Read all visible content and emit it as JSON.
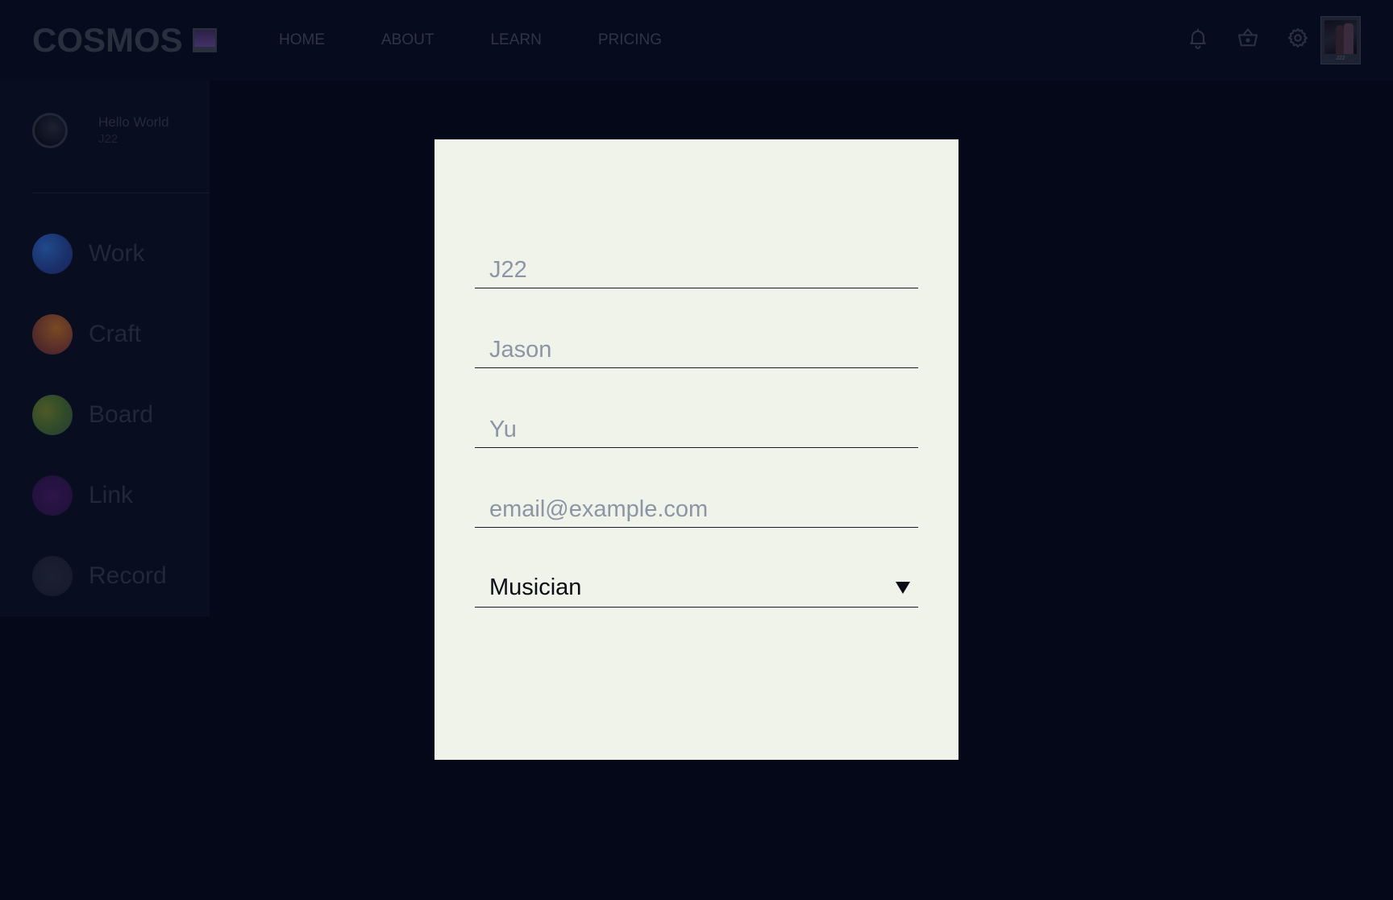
{
  "header": {
    "logo_text": "COSMOS",
    "nav": [
      {
        "label": "HOME"
      },
      {
        "label": "ABOUT"
      },
      {
        "label": "LEARN"
      },
      {
        "label": "PRICING"
      }
    ],
    "icons": [
      "bell-icon",
      "basket-icon",
      "gear-icon"
    ],
    "avatar_caption": "J22"
  },
  "sidebar": {
    "profile": {
      "name": "Hello World",
      "handle": "J22"
    },
    "items": [
      {
        "label": "Work",
        "color": "#1b3a78"
      },
      {
        "label": "Craft",
        "color": "#6a3a2a"
      },
      {
        "label": "Board",
        "color": "#3a4a2a"
      },
      {
        "label": "Link",
        "color": "#2a1848"
      },
      {
        "label": "Record",
        "color": "#181d2e"
      }
    ]
  },
  "modal": {
    "fields": [
      {
        "placeholder": "J22"
      },
      {
        "placeholder": "Jason"
      },
      {
        "placeholder": "Yu"
      },
      {
        "placeholder": "email@example.com"
      }
    ],
    "select": {
      "value": "Musician"
    }
  },
  "colors": {
    "background": "#040818",
    "modal_background": "#f0f3ea",
    "placeholder": "#8c95a5"
  }
}
